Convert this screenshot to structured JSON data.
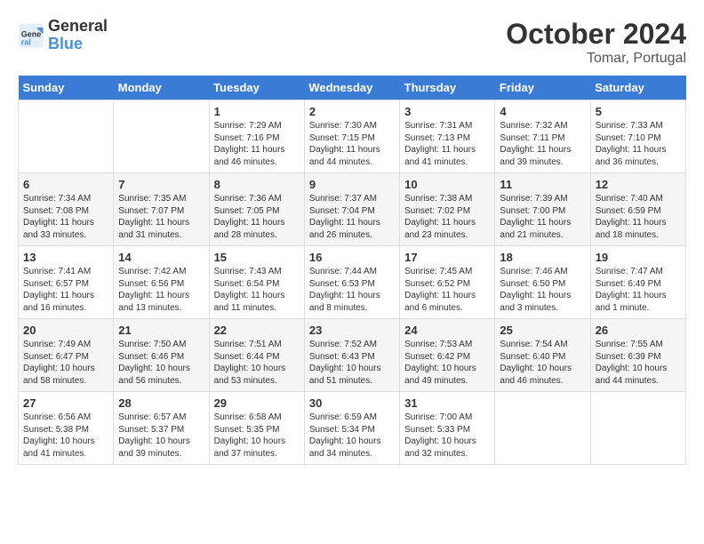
{
  "header": {
    "logo_line1": "General",
    "logo_line2": "Blue",
    "month": "October 2024",
    "location": "Tomar, Portugal"
  },
  "weekdays": [
    "Sunday",
    "Monday",
    "Tuesday",
    "Wednesday",
    "Thursday",
    "Friday",
    "Saturday"
  ],
  "weeks": [
    [
      {
        "day": "",
        "content": ""
      },
      {
        "day": "",
        "content": ""
      },
      {
        "day": "1",
        "content": "Sunrise: 7:29 AM\nSunset: 7:16 PM\nDaylight: 11 hours and 46 minutes."
      },
      {
        "day": "2",
        "content": "Sunrise: 7:30 AM\nSunset: 7:15 PM\nDaylight: 11 hours and 44 minutes."
      },
      {
        "day": "3",
        "content": "Sunrise: 7:31 AM\nSunset: 7:13 PM\nDaylight: 11 hours and 41 minutes."
      },
      {
        "day": "4",
        "content": "Sunrise: 7:32 AM\nSunset: 7:11 PM\nDaylight: 11 hours and 39 minutes."
      },
      {
        "day": "5",
        "content": "Sunrise: 7:33 AM\nSunset: 7:10 PM\nDaylight: 11 hours and 36 minutes."
      }
    ],
    [
      {
        "day": "6",
        "content": "Sunrise: 7:34 AM\nSunset: 7:08 PM\nDaylight: 11 hours and 33 minutes."
      },
      {
        "day": "7",
        "content": "Sunrise: 7:35 AM\nSunset: 7:07 PM\nDaylight: 11 hours and 31 minutes."
      },
      {
        "day": "8",
        "content": "Sunrise: 7:36 AM\nSunset: 7:05 PM\nDaylight: 11 hours and 28 minutes."
      },
      {
        "day": "9",
        "content": "Sunrise: 7:37 AM\nSunset: 7:04 PM\nDaylight: 11 hours and 26 minutes."
      },
      {
        "day": "10",
        "content": "Sunrise: 7:38 AM\nSunset: 7:02 PM\nDaylight: 11 hours and 23 minutes."
      },
      {
        "day": "11",
        "content": "Sunrise: 7:39 AM\nSunset: 7:00 PM\nDaylight: 11 hours and 21 minutes."
      },
      {
        "day": "12",
        "content": "Sunrise: 7:40 AM\nSunset: 6:59 PM\nDaylight: 11 hours and 18 minutes."
      }
    ],
    [
      {
        "day": "13",
        "content": "Sunrise: 7:41 AM\nSunset: 6:57 PM\nDaylight: 11 hours and 16 minutes."
      },
      {
        "day": "14",
        "content": "Sunrise: 7:42 AM\nSunset: 6:56 PM\nDaylight: 11 hours and 13 minutes."
      },
      {
        "day": "15",
        "content": "Sunrise: 7:43 AM\nSunset: 6:54 PM\nDaylight: 11 hours and 11 minutes."
      },
      {
        "day": "16",
        "content": "Sunrise: 7:44 AM\nSunset: 6:53 PM\nDaylight: 11 hours and 8 minutes."
      },
      {
        "day": "17",
        "content": "Sunrise: 7:45 AM\nSunset: 6:52 PM\nDaylight: 11 hours and 6 minutes."
      },
      {
        "day": "18",
        "content": "Sunrise: 7:46 AM\nSunset: 6:50 PM\nDaylight: 11 hours and 3 minutes."
      },
      {
        "day": "19",
        "content": "Sunrise: 7:47 AM\nSunset: 6:49 PM\nDaylight: 11 hours and 1 minute."
      }
    ],
    [
      {
        "day": "20",
        "content": "Sunrise: 7:49 AM\nSunset: 6:47 PM\nDaylight: 10 hours and 58 minutes."
      },
      {
        "day": "21",
        "content": "Sunrise: 7:50 AM\nSunset: 6:46 PM\nDaylight: 10 hours and 56 minutes."
      },
      {
        "day": "22",
        "content": "Sunrise: 7:51 AM\nSunset: 6:44 PM\nDaylight: 10 hours and 53 minutes."
      },
      {
        "day": "23",
        "content": "Sunrise: 7:52 AM\nSunset: 6:43 PM\nDaylight: 10 hours and 51 minutes."
      },
      {
        "day": "24",
        "content": "Sunrise: 7:53 AM\nSunset: 6:42 PM\nDaylight: 10 hours and 49 minutes."
      },
      {
        "day": "25",
        "content": "Sunrise: 7:54 AM\nSunset: 6:40 PM\nDaylight: 10 hours and 46 minutes."
      },
      {
        "day": "26",
        "content": "Sunrise: 7:55 AM\nSunset: 6:39 PM\nDaylight: 10 hours and 44 minutes."
      }
    ],
    [
      {
        "day": "27",
        "content": "Sunrise: 6:56 AM\nSunset: 5:38 PM\nDaylight: 10 hours and 41 minutes."
      },
      {
        "day": "28",
        "content": "Sunrise: 6:57 AM\nSunset: 5:37 PM\nDaylight: 10 hours and 39 minutes."
      },
      {
        "day": "29",
        "content": "Sunrise: 6:58 AM\nSunset: 5:35 PM\nDaylight: 10 hours and 37 minutes."
      },
      {
        "day": "30",
        "content": "Sunrise: 6:59 AM\nSunset: 5:34 PM\nDaylight: 10 hours and 34 minutes."
      },
      {
        "day": "31",
        "content": "Sunrise: 7:00 AM\nSunset: 5:33 PM\nDaylight: 10 hours and 32 minutes."
      },
      {
        "day": "",
        "content": ""
      },
      {
        "day": "",
        "content": ""
      }
    ]
  ]
}
